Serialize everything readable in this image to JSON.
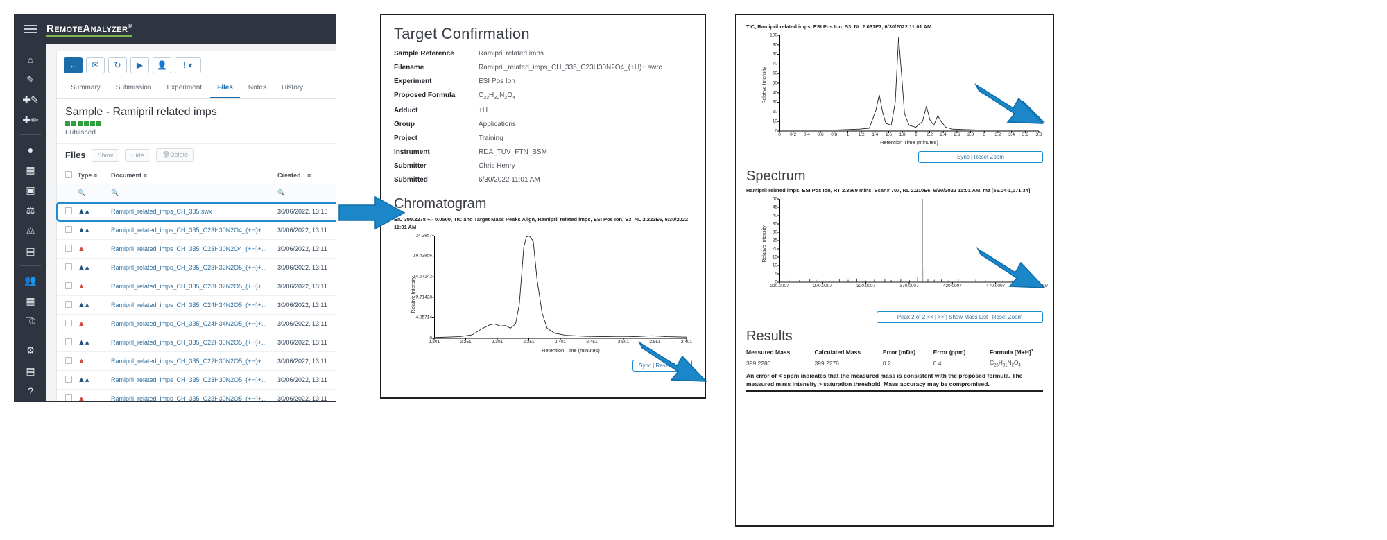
{
  "app": {
    "brand": "RemoteAnalyzer",
    "brand_reg": "®",
    "menu_icon": "hamburger-icon",
    "toolbar": [
      {
        "name": "back-button",
        "glyph": "←",
        "primary": true
      },
      {
        "name": "email-button",
        "glyph": "✉",
        "primary": false
      },
      {
        "name": "refresh-button",
        "glyph": "↻",
        "primary": false
      },
      {
        "name": "run-button",
        "glyph": "▶",
        "primary": false
      },
      {
        "name": "user-button",
        "glyph": "●",
        "primary": false
      },
      {
        "name": "alert-dropdown-button",
        "glyph": "!",
        "primary": false
      }
    ],
    "sidebar_icons": [
      "home-icon",
      "edit-icon",
      "add-sample-icon",
      "add-batch-icon",
      "location-icon",
      "book-icon",
      "tablet-icon",
      "flask-icon",
      "balance-icon",
      "calendar-icon",
      "users-icon",
      "library-icon",
      "workflow-icon",
      "settings-icon",
      "document-icon",
      "help-icon"
    ],
    "tabs": [
      {
        "label": "Summary",
        "active": false
      },
      {
        "label": "Submission",
        "active": false
      },
      {
        "label": "Experiment",
        "active": false
      },
      {
        "label": "Files",
        "active": true
      },
      {
        "label": "Notes",
        "active": false
      },
      {
        "label": "History",
        "active": false
      }
    ],
    "sample_title": "Sample - Ramipril related imps",
    "status_label": "Published",
    "files_section": {
      "title": "Files",
      "buttons": [
        "Show",
        "Hide",
        "Delete"
      ],
      "columns": [
        "Type",
        "Document",
        "Created"
      ],
      "sort_indicator": "↑",
      "filter_icon": "filter-icon",
      "search_icon": "search-icon",
      "rows": [
        {
          "type": "peak",
          "document": "Ramipril_related_imps_CH_335.swx",
          "created": "30/06/2022, 13:10",
          "highlighted": true
        },
        {
          "type": "peak",
          "document": "Ramipril_related_imps_CH_335_C23H30N2O4_(+H)+...",
          "created": "30/06/2022, 13:11",
          "highlighted": false
        },
        {
          "type": "pdf",
          "document": "Ramipril_related_imps_CH_335_C23H30N2O4_(+H)+...",
          "created": "30/06/2022, 13:11",
          "highlighted": false
        },
        {
          "type": "peak",
          "document": "Ramipril_related_imps_CH_335_C23H32N2O5_(+H)+...",
          "created": "30/06/2022, 13:11",
          "highlighted": false
        },
        {
          "type": "pdf",
          "document": "Ramipril_related_imps_CH_335_C23H32N2O5_(+H)+...",
          "created": "30/06/2022, 13:11",
          "highlighted": false
        },
        {
          "type": "peak",
          "document": "Ramipril_related_imps_CH_335_C24H34N2O5_(+H)+...",
          "created": "30/06/2022, 13:11",
          "highlighted": false
        },
        {
          "type": "pdf",
          "document": "Ramipril_related_imps_CH_335_C24H34N2O5_(+H)+...",
          "created": "30/06/2022, 13:11",
          "highlighted": false
        },
        {
          "type": "peak",
          "document": "Ramipril_related_imps_CH_335_C22H30N2O5_(+H)+...",
          "created": "30/06/2022, 13:11",
          "highlighted": false
        },
        {
          "type": "pdf",
          "document": "Ramipril_related_imps_CH_335_C22H30N2O5_(+H)+...",
          "created": "30/06/2022, 13:11",
          "highlighted": false
        },
        {
          "type": "peak",
          "document": "Ramipril_related_imps_CH_335_C23H30N2O5_(+H)+...",
          "created": "30/06/2022, 13:11",
          "highlighted": false
        },
        {
          "type": "pdf",
          "document": "Ramipril_related_imps_CH_335_C23H30N2O5_(+H)+...",
          "created": "30/06/2022, 13:11",
          "highlighted": false
        }
      ]
    }
  },
  "report": {
    "title": "Target Confirmation",
    "fields": [
      {
        "label": "Sample Reference",
        "value": "Ramipril related imps"
      },
      {
        "label": "Filename",
        "value": "Ramipril_related_imps_CH_335_C23H30N2O4_(+H)+.swrc"
      },
      {
        "label": "Experiment",
        "value": "ESI Pos Ion"
      },
      {
        "label": "Proposed Formula",
        "value": "C23H30N2O4",
        "formula": true
      },
      {
        "label": "Adduct",
        "value": "+H"
      },
      {
        "label": "Group",
        "value": "Applications"
      },
      {
        "label": "Project",
        "value": "Training"
      },
      {
        "label": "Instrument",
        "value": "RDA_TUV_FTN_BSM"
      },
      {
        "label": "Submitter",
        "value": "Chris Henry"
      },
      {
        "label": "Submitted",
        "value": "6/30/2022 11:01 AM"
      }
    ],
    "chromatogram_heading": "Chromatogram",
    "chrom_sync_label": "Sync | Reset Zoom",
    "spectrum_heading": "Spectrum",
    "tic_sync_label": "Sync | Reset Zoom",
    "spectrum_nav_label": "Peak 2 of 2 << | >> | Show Mass List | Reset Zoom",
    "results_heading": "Results",
    "results_columns": [
      "Measured Mass",
      "Calculated Mass",
      "Error (mDa)",
      "Error (ppm)",
      "Formula [M+H]"
    ],
    "results_formula_sup": "+",
    "results_row": {
      "measured_mass": "399.2280",
      "calculated_mass": "399.2278",
      "error_mda": "0.2",
      "error_ppm": "0.4",
      "formula": "C23H31N2O4"
    },
    "results_note": "An error of < 5ppm indicates that the measured mass is consistent with the proposed formula. The measured mass intensity > saturation threshold. Mass accuracy may be compromised."
  },
  "chart_data": [
    {
      "type": "line",
      "id": "chromatogram",
      "title": "EIC 399.2278 +/- 0.0500, TIC and Target Mass Peaks Align, Ramipril related imps, ESI Pos Ion, S3, NL 2.222E6, 6/30/2022 11:01 AM",
      "xlabel": "Retention Time (minutes)",
      "ylabel": "Relative Intensity",
      "xticks": [
        "2.201",
        "2.251",
        "2.301",
        "2.351",
        "2.401",
        "2.451",
        "2.501",
        "2.551",
        "2.401"
      ],
      "yticks": [
        "24.2857",
        "19.42856",
        "14.57142",
        "9.71428",
        "4.85714",
        "0"
      ],
      "xlim": [
        2.201,
        2.601
      ],
      "ylim": [
        0,
        24.2857
      ],
      "points": [
        [
          2.201,
          0.2
        ],
        [
          2.221,
          0.3
        ],
        [
          2.241,
          0.4
        ],
        [
          2.261,
          0.8
        ],
        [
          2.276,
          2.2
        ],
        [
          2.288,
          3.1
        ],
        [
          2.296,
          3.4
        ],
        [
          2.306,
          2.9
        ],
        [
          2.314,
          3.0
        ],
        [
          2.322,
          2.4
        ],
        [
          2.33,
          3.4
        ],
        [
          2.336,
          8.0
        ],
        [
          2.343,
          21.5
        ],
        [
          2.347,
          24.0
        ],
        [
          2.352,
          24.2
        ],
        [
          2.358,
          23.0
        ],
        [
          2.364,
          14.0
        ],
        [
          2.372,
          6.0
        ],
        [
          2.38,
          2.4
        ],
        [
          2.392,
          1.2
        ],
        [
          2.41,
          0.7
        ],
        [
          2.44,
          0.5
        ],
        [
          2.47,
          0.4
        ],
        [
          2.5,
          0.5
        ],
        [
          2.52,
          0.4
        ],
        [
          2.545,
          0.6
        ],
        [
          2.57,
          0.4
        ],
        [
          2.601,
          0.3
        ]
      ]
    },
    {
      "type": "line",
      "id": "tic",
      "title": "TIC, Ramipril related imps, ESI Pos Ion, S3, NL 2.031E7, 6/30/2022 11:01 AM",
      "xlabel": "Retention Time (minutes)",
      "ylabel": "Relative Intensity",
      "xticks": [
        "0",
        "0.2",
        "0.4",
        "0.6",
        "0.8",
        "1",
        "1.2",
        "1.4",
        "1.6",
        "1.8",
        "2",
        "2.2",
        "2.4",
        "2.6",
        "2.8",
        "3",
        "3.2",
        "3.4",
        "3.6",
        "3.8"
      ],
      "yticks": [
        "100",
        "90",
        "80",
        "70",
        "60",
        "50",
        "40",
        "30",
        "20",
        "10",
        "0"
      ],
      "xlim": [
        0,
        3.9
      ],
      "ylim": [
        0,
        100
      ],
      "points": [
        [
          0,
          1
        ],
        [
          0.2,
          1
        ],
        [
          0.4,
          1
        ],
        [
          0.6,
          1
        ],
        [
          0.8,
          1
        ],
        [
          1.0,
          1.5
        ],
        [
          1.2,
          2
        ],
        [
          1.35,
          3
        ],
        [
          1.45,
          22
        ],
        [
          1.5,
          38
        ],
        [
          1.55,
          20
        ],
        [
          1.6,
          8
        ],
        [
          1.68,
          6
        ],
        [
          1.74,
          30
        ],
        [
          1.79,
          98
        ],
        [
          1.84,
          55
        ],
        [
          1.88,
          18
        ],
        [
          1.95,
          6
        ],
        [
          2.05,
          4
        ],
        [
          2.15,
          10
        ],
        [
          2.21,
          26
        ],
        [
          2.26,
          12
        ],
        [
          2.32,
          6
        ],
        [
          2.38,
          16
        ],
        [
          2.43,
          10
        ],
        [
          2.5,
          4
        ],
        [
          2.6,
          2
        ],
        [
          2.8,
          1.5
        ],
        [
          3.0,
          1
        ],
        [
          3.2,
          1
        ],
        [
          3.4,
          1
        ],
        [
          3.6,
          1
        ],
        [
          3.8,
          1
        ]
      ]
    },
    {
      "type": "line",
      "id": "spectrum",
      "title": "Ramipril related imps, ESI Pos Ion, RT 2.3569 mins, Scan# 707, NL 2.210E6, 6/30/2022 11:01 AM, mz [56.04-1,071.34]",
      "xlabel": "",
      "ylabel": "Relative Intensity",
      "xticks": [
        "220.0007",
        "270.0007",
        "320.0007",
        "370.0007",
        "420.0007",
        "470.0007",
        "520.0007"
      ],
      "yticks": [
        "50",
        "45",
        "40",
        "35",
        "30",
        "25",
        "20",
        "15",
        "10",
        "5",
        "0"
      ],
      "xlim": [
        220,
        545
      ],
      "ylim": [
        0,
        50
      ],
      "peaks": [
        [
          232,
          1.5
        ],
        [
          245,
          1.2
        ],
        [
          258,
          2.0
        ],
        [
          266,
          1.4
        ],
        [
          277,
          2.6
        ],
        [
          288,
          1.2
        ],
        [
          295,
          1.8
        ],
        [
          306,
          1.4
        ],
        [
          317,
          2.2
        ],
        [
          328,
          1.0
        ],
        [
          339,
          1.5
        ],
        [
          352,
          2.0
        ],
        [
          360,
          1.3
        ],
        [
          372,
          1.8
        ],
        [
          383,
          1.2
        ],
        [
          393,
          3.0
        ],
        [
          399,
          50
        ],
        [
          401,
          8
        ],
        [
          406,
          2.0
        ],
        [
          414,
          1.4
        ],
        [
          423,
          1.6
        ],
        [
          432,
          1.1
        ],
        [
          444,
          1.8
        ],
        [
          455,
          1.2
        ],
        [
          466,
          1.5
        ],
        [
          478,
          1.1
        ],
        [
          489,
          1.6
        ],
        [
          500,
          1.2
        ],
        [
          512,
          1.0
        ],
        [
          524,
          1.4
        ],
        [
          536,
          1.0
        ]
      ]
    }
  ],
  "arrows": {
    "count": 3,
    "color": "#1b87c9"
  }
}
